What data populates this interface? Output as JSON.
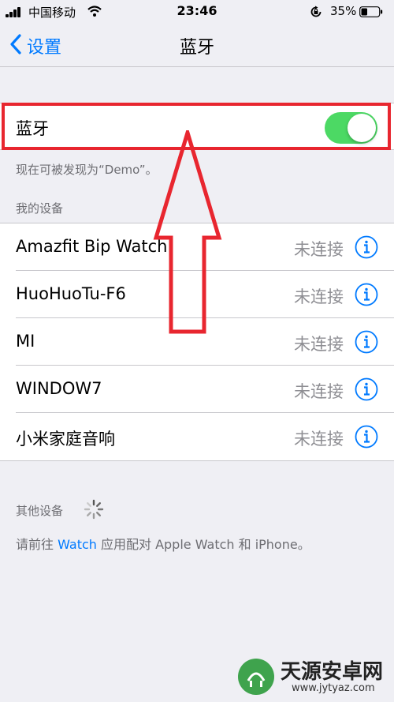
{
  "status_bar": {
    "carrier": "中国移动",
    "time": "23:46",
    "battery_percent": "35%",
    "battery_level": 0.35,
    "icons": [
      "signal-icon",
      "wifi-icon",
      "orientation-lock-icon",
      "battery-icon"
    ]
  },
  "nav": {
    "back_label": "设置",
    "title": "蓝牙"
  },
  "bluetooth": {
    "label": "蓝牙",
    "enabled": true,
    "discoverable_text": "现在可被发现为“Demo”。"
  },
  "my_devices": {
    "header": "我的设备",
    "items": [
      {
        "name": "Amazfit Bip Watch",
        "status": "未连接"
      },
      {
        "name": "HuoHuoTu-F6",
        "status": "未连接"
      },
      {
        "name": "MI",
        "status": "未连接"
      },
      {
        "name": "WINDOW7",
        "status": "未连接"
      },
      {
        "name": "小米家庭音响",
        "status": "未连接"
      }
    ]
  },
  "other_devices": {
    "header": "其他设备",
    "footer_prefix": "请前往 ",
    "footer_link": "Watch",
    "footer_suffix": " 应用配对 Apple Watch 和 iPhone。"
  },
  "watermark": {
    "title": "天源安卓网",
    "url": "www.jytyaz.com"
  },
  "colors": {
    "accent": "#007aff",
    "toggle_on": "#4cd964",
    "annotation_red": "#e8262f",
    "background": "#efeff4"
  }
}
